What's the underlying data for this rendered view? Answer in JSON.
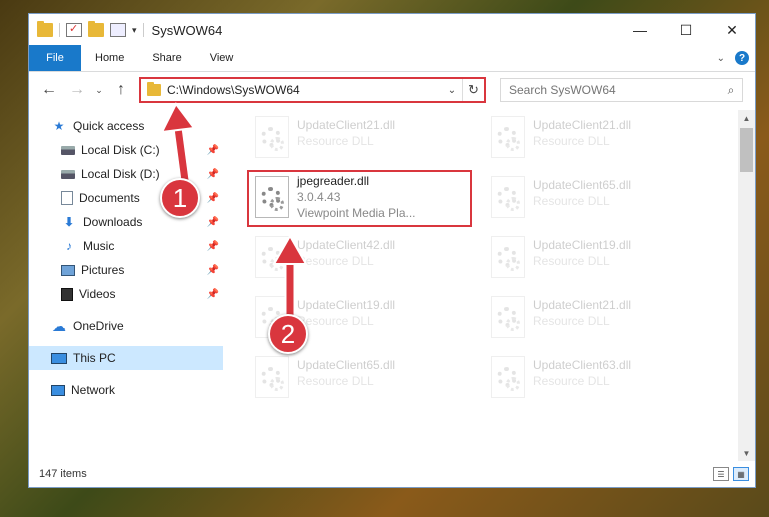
{
  "window": {
    "title": "SysWOW64",
    "qat_dropdown": "▾",
    "controls": {
      "minimize": "—",
      "maximize": "☐",
      "close": "✕"
    }
  },
  "ribbon": {
    "tabs": [
      {
        "label": "File"
      },
      {
        "label": "Home"
      },
      {
        "label": "Share"
      },
      {
        "label": "View"
      }
    ],
    "collapse": "⌄",
    "help": "?"
  },
  "address": {
    "back": "←",
    "forward": "→",
    "recent": "⌄",
    "up": "↑",
    "path": "C:\\Windows\\SysWOW64",
    "dropdown": "⌄",
    "refresh": "↻"
  },
  "search": {
    "placeholder": "Search SysWOW64",
    "icon": "⌕"
  },
  "nav": {
    "items": [
      {
        "label": "Quick access",
        "glyph": "★"
      },
      {
        "label": "Local Disk (C:)",
        "pin": "📌"
      },
      {
        "label": "Local Disk (D:)",
        "pin": "📌"
      },
      {
        "label": "Documents",
        "pin": "📌"
      },
      {
        "label": "Downloads",
        "glyph": "⬇",
        "pin": "📌"
      },
      {
        "label": "Music",
        "glyph": "♪",
        "pin": "📌"
      },
      {
        "label": "Pictures",
        "pin": "📌"
      },
      {
        "label": "Videos",
        "pin": "📌"
      },
      {
        "label": "OneDrive",
        "glyph": "☁"
      },
      {
        "label": "This PC"
      },
      {
        "label": "Network"
      }
    ]
  },
  "files": [
    {
      "name": "UpdateClient21.dll",
      "line2": "Resource DLL"
    },
    {
      "name": "UpdateClient21.dll",
      "line2": "Resource DLL"
    },
    {
      "name": "jpegreader.dll",
      "line2": "3.0.4.43",
      "line3": "Viewpoint Media Pla..."
    },
    {
      "name": "UpdateClient65.dll",
      "line2": "Resource DLL"
    },
    {
      "name": "UpdateClient42.dll",
      "line2": "Resource DLL"
    },
    {
      "name": "UpdateClient19.dll",
      "line2": "Resource DLL"
    },
    {
      "name": "UpdateClient19.dll",
      "line2": "Resource DLL"
    },
    {
      "name": "UpdateClient21.dll",
      "line2": "Resource DLL"
    },
    {
      "name": "UpdateClient65.dll",
      "line2": "Resource DLL"
    },
    {
      "name": "UpdateClient63.dll",
      "line2": "Resource DLL"
    }
  ],
  "scrollbar": {
    "up": "▲",
    "down": "▼"
  },
  "status": {
    "item_count": "147 items",
    "view_details": "☰",
    "view_tiles": "▦"
  },
  "annotations": {
    "step1": "1",
    "step2": "2"
  },
  "colors": {
    "accent": "#1979ca",
    "highlight": "#d9363e",
    "selected": "#cce8ff"
  }
}
